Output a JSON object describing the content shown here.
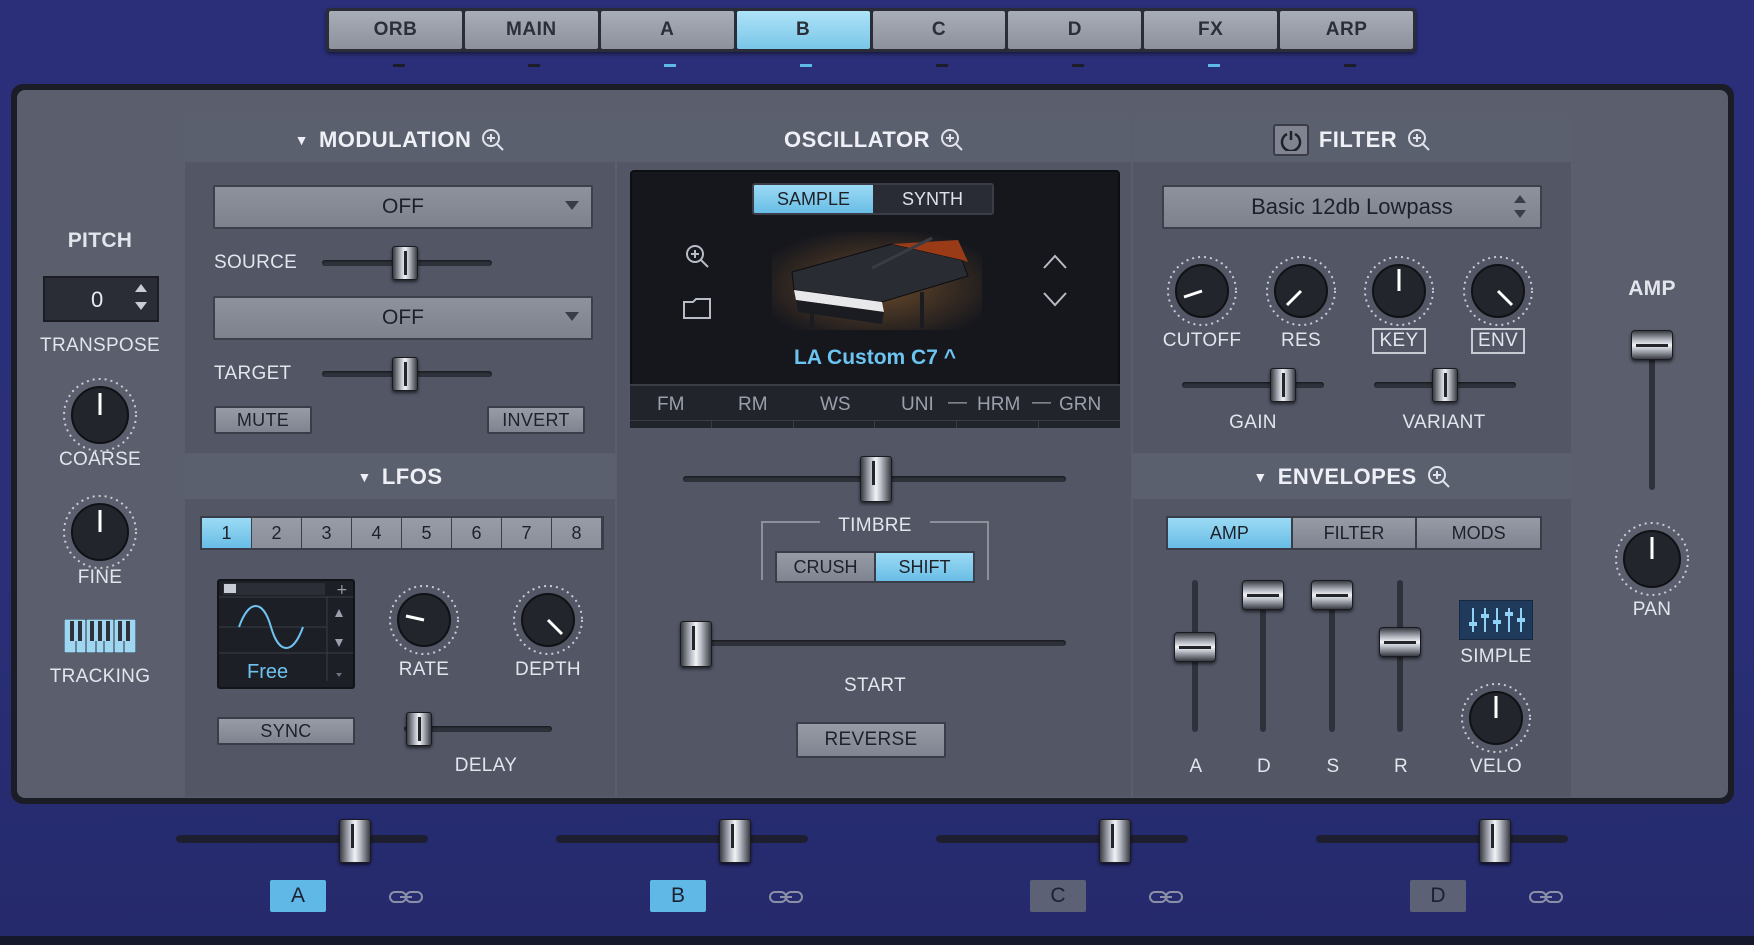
{
  "tabs": [
    {
      "label": "ORB",
      "indicator": false
    },
    {
      "label": "MAIN",
      "indicator": false
    },
    {
      "label": "A",
      "indicator": true
    },
    {
      "label": "B",
      "indicator": true,
      "active": true
    },
    {
      "label": "C",
      "indicator": false
    },
    {
      "label": "D",
      "indicator": false
    },
    {
      "label": "FX",
      "indicator": true
    },
    {
      "label": "ARP",
      "indicator": false
    }
  ],
  "pitch": {
    "title": "PITCH",
    "transpose_value": "0",
    "transpose_label": "TRANSPOSE",
    "coarse_label": "COARSE",
    "fine_label": "FINE",
    "tracking_label": "TRACKING"
  },
  "modulation": {
    "title": "MODULATION",
    "source_select": "OFF",
    "source_label": "SOURCE",
    "target_select": "OFF",
    "target_label": "TARGET",
    "mute_label": "MUTE",
    "invert_label": "INVERT"
  },
  "lfos": {
    "title": "LFOS",
    "numbers": [
      "1",
      "2",
      "3",
      "4",
      "5",
      "6",
      "7",
      "8"
    ],
    "active": 1,
    "waveform_label": "Free",
    "rate_label": "RATE",
    "depth_label": "DEPTH",
    "sync_label": "SYNC",
    "delay_label": "DELAY"
  },
  "oscillator": {
    "title": "OSCILLATOR",
    "mode_sample": "SAMPLE",
    "mode_synth": "SYNTH",
    "active_mode": "SAMPLE",
    "instrument_name": "LA Custom C7 ^",
    "mod_tabs": [
      "FM",
      "RM",
      "WS",
      "UNI",
      "HRM",
      "GRN"
    ],
    "timbre_label": "TIMBRE",
    "crush_label": "CRUSH",
    "shift_label": "SHIFT",
    "start_label": "START",
    "reverse_label": "REVERSE"
  },
  "filter": {
    "title": "FILTER",
    "type": "Basic 12db Lowpass",
    "cutoff_label": "CUTOFF",
    "res_label": "RES",
    "key_label": "KEY",
    "env_label": "ENV",
    "gain_label": "GAIN",
    "variant_label": "VARIANT"
  },
  "envelopes": {
    "title": "ENVELOPES",
    "tabs": [
      "AMP",
      "FILTER",
      "MODS"
    ],
    "active_tab": "AMP",
    "adsr_labels": [
      "A",
      "D",
      "S",
      "R"
    ],
    "simple_label": "SIMPLE",
    "velo_label": "VELO"
  },
  "amp": {
    "title": "AMP",
    "pan_label": "PAN"
  },
  "macros": [
    {
      "label": "A",
      "active": true
    },
    {
      "label": "B",
      "active": true
    },
    {
      "label": "C",
      "active": false
    },
    {
      "label": "D",
      "active": false
    }
  ],
  "colors": {
    "accent": "#79c6e8",
    "background": "#2a2f78",
    "panel": "#525665",
    "instrument_text": "#6cc4f0"
  }
}
